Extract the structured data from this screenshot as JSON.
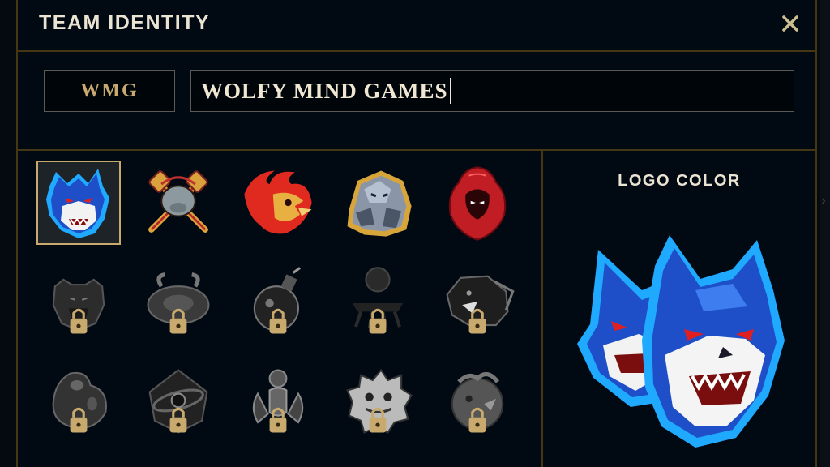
{
  "dialog": {
    "title": "TEAM IDENTITY",
    "close_icon": "close-icon"
  },
  "team": {
    "tag": "WMG",
    "name": "WOLFY MIND GAMES"
  },
  "logos": [
    {
      "id": "wolf",
      "icon": "wolf-logo-icon",
      "locked": false,
      "selected": true
    },
    {
      "id": "manatee",
      "icon": "manatee-paddles-logo-icon",
      "locked": false,
      "selected": false
    },
    {
      "id": "phoenix",
      "icon": "fire-bird-logo-icon",
      "locked": false,
      "selected": false
    },
    {
      "id": "rock-golem",
      "icon": "rock-golem-logo-icon",
      "locked": false,
      "selected": false
    },
    {
      "id": "hooded",
      "icon": "red-hooded-figure-logo-icon",
      "locked": false,
      "selected": false
    },
    {
      "id": "bear",
      "icon": "bear-logo-icon",
      "locked": true,
      "selected": false
    },
    {
      "id": "crab-turtle",
      "icon": "crab-turtle-logo-icon",
      "locked": true,
      "selected": false
    },
    {
      "id": "bomb",
      "icon": "bomb-logo-icon",
      "locked": true,
      "selected": false
    },
    {
      "id": "totem",
      "icon": "totem-logo-icon",
      "locked": true,
      "selected": false
    },
    {
      "id": "panther",
      "icon": "panther-logo-icon",
      "locked": true,
      "selected": false
    },
    {
      "id": "egg-claw",
      "icon": "claw-egg-logo-icon",
      "locked": true,
      "selected": false
    },
    {
      "id": "galaxy",
      "icon": "galaxy-logo-icon",
      "locked": true,
      "selected": false
    },
    {
      "id": "claw",
      "icon": "claw-logo-icon",
      "locked": true,
      "selected": false
    },
    {
      "id": "furball",
      "icon": "furball-logo-icon",
      "locked": true,
      "selected": false
    },
    {
      "id": "rhino",
      "icon": "rhino-logo-icon",
      "locked": true,
      "selected": false
    }
  ],
  "preview": {
    "label": "LOGO COLOR",
    "icon": "wolf-logo-large-icon"
  },
  "colors": {
    "gold_border": "#463714",
    "gold_text": "#c8aa6e",
    "bg": "#010a13",
    "wolf_blue": "#1e5fd8",
    "wolf_outline": "#1fa9ff"
  }
}
